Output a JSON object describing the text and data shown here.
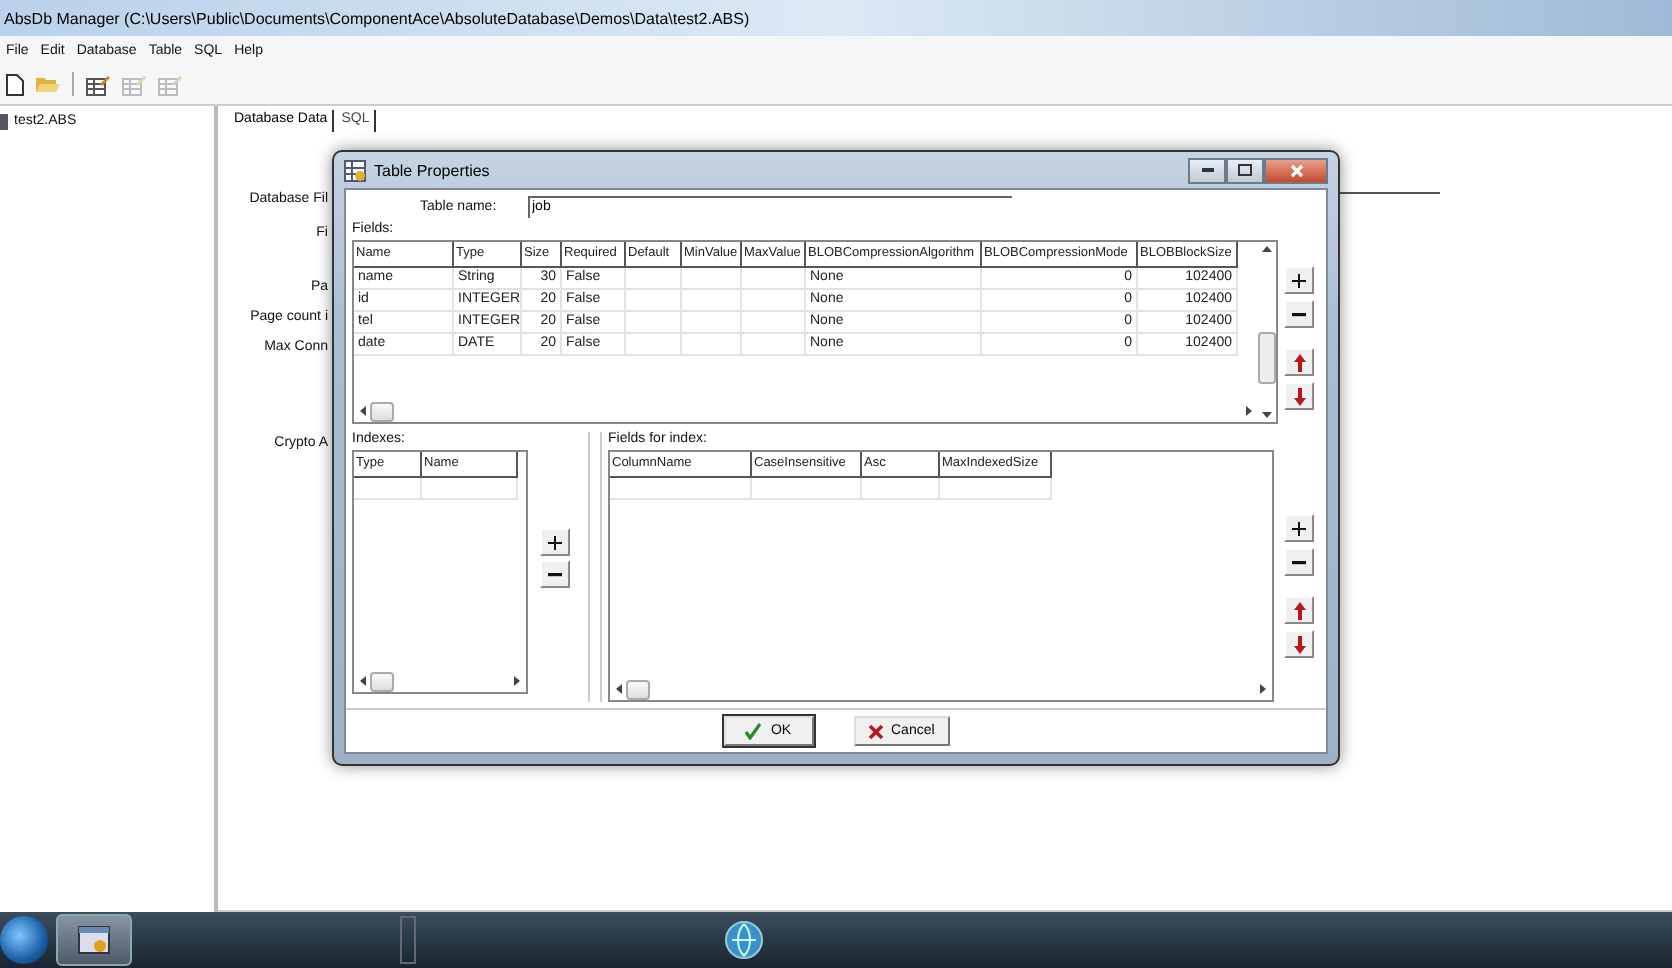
{
  "window": {
    "title": "AbsDb Manager (C:\\Users\\Public\\Documents\\ComponentAce\\AbsoluteDatabase\\Demos\\Data\\test2.ABS)"
  },
  "menu": [
    "File",
    "Edit",
    "Database",
    "Table",
    "SQL",
    "Help"
  ],
  "toolbar": [
    {
      "kind": "new",
      "disabled": false
    },
    {
      "kind": "open",
      "disabled": false
    },
    {
      "kind": "separator",
      "disabled": false
    },
    {
      "kind": "table",
      "disabled": false
    },
    {
      "kind": "table",
      "disabled": true
    },
    {
      "kind": "table",
      "disabled": true
    }
  ],
  "tree": [
    {
      "label": "test2.ABS",
      "selected": false
    }
  ],
  "tabs": [
    {
      "label": "Database Data",
      "selected": true
    },
    {
      "label": "SQL",
      "selected": false
    }
  ],
  "properties": [
    "Database Fil",
    "Fi",
    "Pa",
    "Page count i",
    "Max Conn",
    "Crypto A"
  ],
  "dialog": {
    "title": "Table Properties",
    "table_name_label": "Table name:",
    "table_name": "job",
    "fields_label": "Fields:",
    "fields": {
      "columns": [
        "Name",
        "Type",
        "Size",
        "Required",
        "Default",
        "MinValue",
        "MaxValue",
        "BLOBCompressionAlgorithm",
        "BLOBCompressionMode",
        "BLOBBlockSize"
      ],
      "rows": [
        [
          "name",
          "String",
          "30",
          "False",
          null,
          null,
          null,
          "None",
          "0",
          "102400"
        ],
        [
          "id",
          "INTEGER",
          "20",
          "False",
          null,
          null,
          null,
          "None",
          "0",
          "102400"
        ],
        [
          "tel",
          "INTEGER",
          "20",
          "False",
          null,
          null,
          null,
          "None",
          "0",
          "102400"
        ],
        [
          "date",
          "DATE",
          "20",
          "False",
          null,
          null,
          null,
          "None",
          "0",
          "102400"
        ]
      ]
    },
    "indexes_label": "Indexes:",
    "indexes": {
      "columns": [
        "Type",
        "Name"
      ]
    },
    "fields_for_index_label": "Fields for index:",
    "index_fields": {
      "columns": [
        "ColumnName",
        "CaseInsensitive",
        "Asc",
        "MaxIndexedSize"
      ]
    },
    "buttons": [
      {
        "label": "OK",
        "kind": "ok"
      },
      {
        "label": "Cancel",
        "kind": "cancel"
      }
    ]
  }
}
